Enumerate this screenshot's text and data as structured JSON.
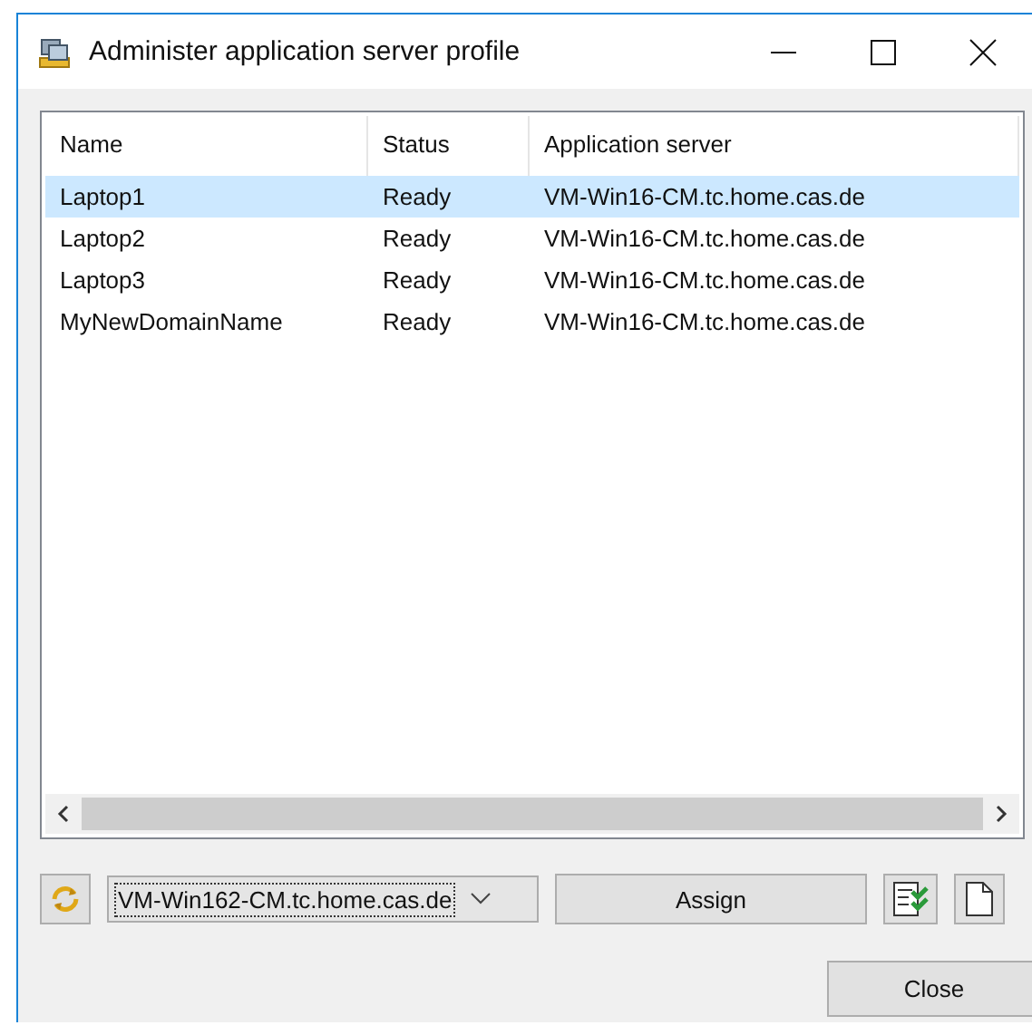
{
  "window": {
    "title": "Administer application server profile"
  },
  "table": {
    "columns": [
      "Name",
      "Status",
      "Application server"
    ],
    "rows": [
      {
        "cells": [
          "Laptop1",
          "Ready",
          "VM-Win16-CM.tc.home.cas.de"
        ],
        "selected": true
      },
      {
        "cells": [
          "Laptop2",
          "Ready",
          "VM-Win16-CM.tc.home.cas.de"
        ],
        "selected": false
      },
      {
        "cells": [
          "Laptop3",
          "Ready",
          "VM-Win16-CM.tc.home.cas.de"
        ],
        "selected": false
      },
      {
        "cells": [
          "MyNewDomainName",
          "Ready",
          "VM-Win16-CM.tc.home.cas.de"
        ],
        "selected": false
      }
    ]
  },
  "server_dropdown": {
    "value": "VM-Win162-CM.tc.home.cas.de"
  },
  "buttons": {
    "assign": "Assign",
    "close": "Close"
  }
}
